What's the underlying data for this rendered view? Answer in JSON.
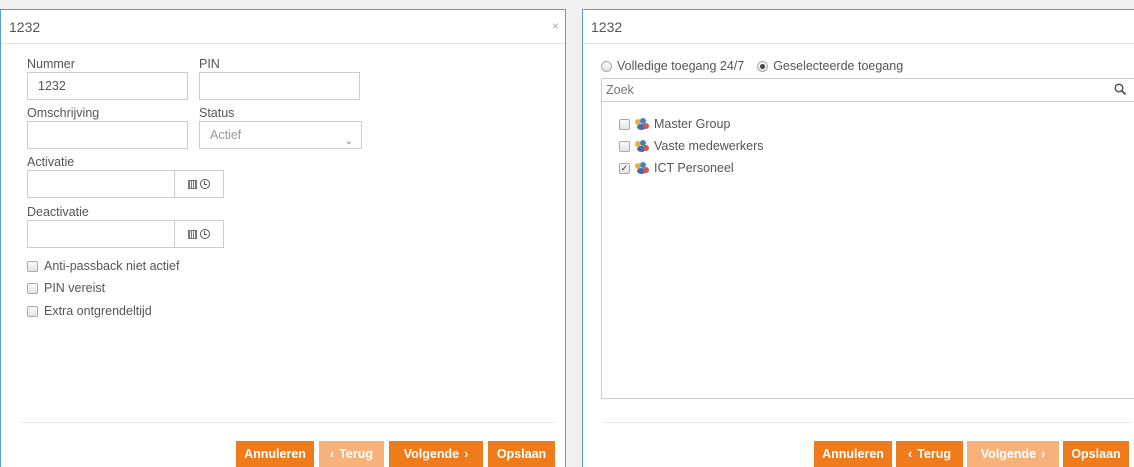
{
  "left_dialog": {
    "title": "1232",
    "close": "×",
    "labels": {
      "nummer": "Nummer",
      "pin": "PIN",
      "omschrijving": "Omschrijving",
      "status": "Status",
      "activatie": "Activatie",
      "deactivatie": "Deactivatie"
    },
    "fields": {
      "nummer_value": "1232",
      "pin_value": "",
      "omschrijving_value": "",
      "status_value": "Actief",
      "activatie_value": "",
      "deactivatie_value": ""
    },
    "checkboxes": [
      {
        "label": "Anti-passback niet actief",
        "checked": false
      },
      {
        "label": "PIN vereist",
        "checked": false
      },
      {
        "label": "Extra ontgrendeltijd",
        "checked": false
      }
    ],
    "buttons": {
      "annuleren": "Annuleren",
      "terug": "Terug",
      "volgende": "Volgende",
      "opslaan": "Opslaan"
    }
  },
  "right_dialog": {
    "title": "1232",
    "close": "×",
    "access_options": [
      {
        "label": "Volledige toegang 24/7",
        "selected": false
      },
      {
        "label": "Geselecteerde toegang",
        "selected": true
      }
    ],
    "search_placeholder": "Zoek",
    "groups": [
      {
        "label": "Master Group",
        "checked": false
      },
      {
        "label": "Vaste medewerkers",
        "checked": false
      },
      {
        "label": "ICT Personeel",
        "checked": true
      }
    ],
    "buttons": {
      "annuleren": "Annuleren",
      "terug": "Terug",
      "volgende": "Volgende",
      "opslaan": "Opslaan"
    }
  },
  "colors": {
    "accent": "#f07b1a",
    "accent_disabled": "#f6b27a",
    "dialog_border": "#5b9bd5"
  },
  "icons": [
    "calendar-icon",
    "clock-icon",
    "chevron-down-icon",
    "search-icon",
    "group-icon",
    "chevron-left-icon",
    "chevron-right-icon",
    "close-icon"
  ]
}
